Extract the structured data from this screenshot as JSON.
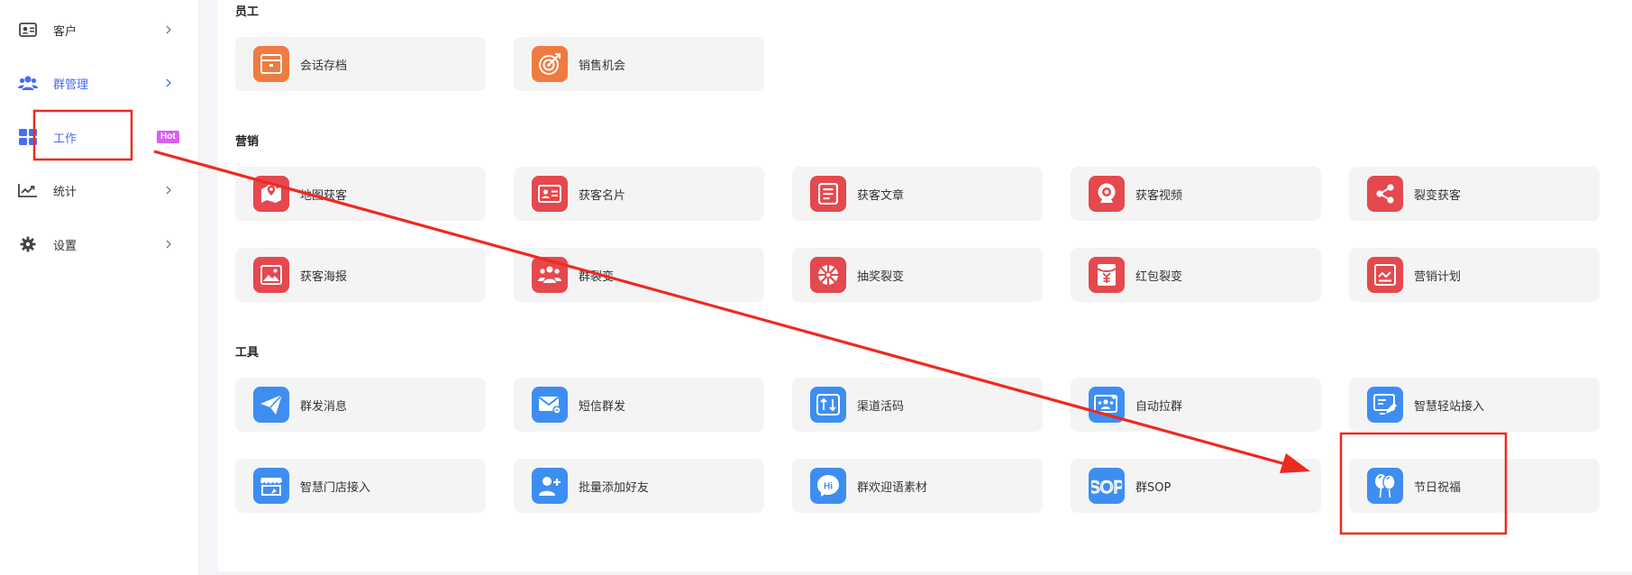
{
  "sidebar": {
    "items": [
      {
        "label": "客户",
        "icon": "customer-card-icon"
      },
      {
        "label": "群管理",
        "icon": "group-users-icon"
      },
      {
        "label": "工作",
        "icon": "grid-apps-icon",
        "badge": "Hot"
      },
      {
        "label": "统计",
        "icon": "line-chart-icon"
      },
      {
        "label": "设置",
        "icon": "gear-icon"
      }
    ]
  },
  "sections": [
    {
      "title": "员工",
      "cards": [
        {
          "label": "会话存档",
          "icon": "archive-box-icon",
          "color": "#f07b3f"
        },
        {
          "label": "销售机会",
          "icon": "target-icon",
          "color": "#f07b3f"
        }
      ]
    },
    {
      "title": "营销",
      "cards": [
        {
          "label": "地图获客",
          "icon": "map-icon",
          "color": "#e5484d"
        },
        {
          "label": "获客名片",
          "icon": "id-card-icon",
          "color": "#e5484d"
        },
        {
          "label": "获客文章",
          "icon": "document-icon",
          "color": "#e5484d"
        },
        {
          "label": "获客视频",
          "icon": "camera-icon",
          "color": "#e5484d"
        },
        {
          "label": "裂变获客",
          "icon": "share-icon",
          "color": "#e5484d"
        },
        {
          "label": "获客海报",
          "icon": "image-icon",
          "color": "#e5484d"
        },
        {
          "label": "群裂变",
          "icon": "group-people-icon",
          "color": "#e5484d"
        },
        {
          "label": "抽奖裂变",
          "icon": "lottery-wheel-icon",
          "color": "#e5484d"
        },
        {
          "label": "红包裂变",
          "icon": "red-envelope-icon",
          "color": "#e5484d"
        },
        {
          "label": "营销计划",
          "icon": "plan-chart-icon",
          "color": "#e5484d"
        }
      ]
    },
    {
      "title": "工具",
      "cards": [
        {
          "label": "群发消息",
          "icon": "paper-plane-icon",
          "color": "#3d8ef0"
        },
        {
          "label": "短信群发",
          "icon": "envelope-icon",
          "color": "#3d8ef0"
        },
        {
          "label": "渠道活码",
          "icon": "channel-code-icon",
          "color": "#3d8ef0"
        },
        {
          "label": "自动拉群",
          "icon": "auto-group-icon",
          "color": "#3d8ef0"
        },
        {
          "label": "智慧轻站接入",
          "icon": "site-edit-icon",
          "color": "#3d8ef0"
        },
        {
          "label": "智慧门店接入",
          "icon": "store-icon",
          "color": "#3d8ef0"
        },
        {
          "label": "批量添加好友",
          "icon": "add-user-icon",
          "color": "#3d8ef0"
        },
        {
          "label": "群欢迎语素材",
          "icon": "hi-bubble-icon",
          "color": "#3d8ef0",
          "icon_text": "Hi"
        },
        {
          "label": "群SOP",
          "icon": "sop-icon",
          "color": "#3d8ef0",
          "icon_text": "SOP"
        },
        {
          "label": "节日祝福",
          "icon": "balloons-icon",
          "color": "#3d8ef0"
        }
      ]
    }
  ],
  "colors": {
    "accent": "#4a6cf7",
    "badge": "#d95ef2",
    "annotation": "#ee2a1f"
  }
}
